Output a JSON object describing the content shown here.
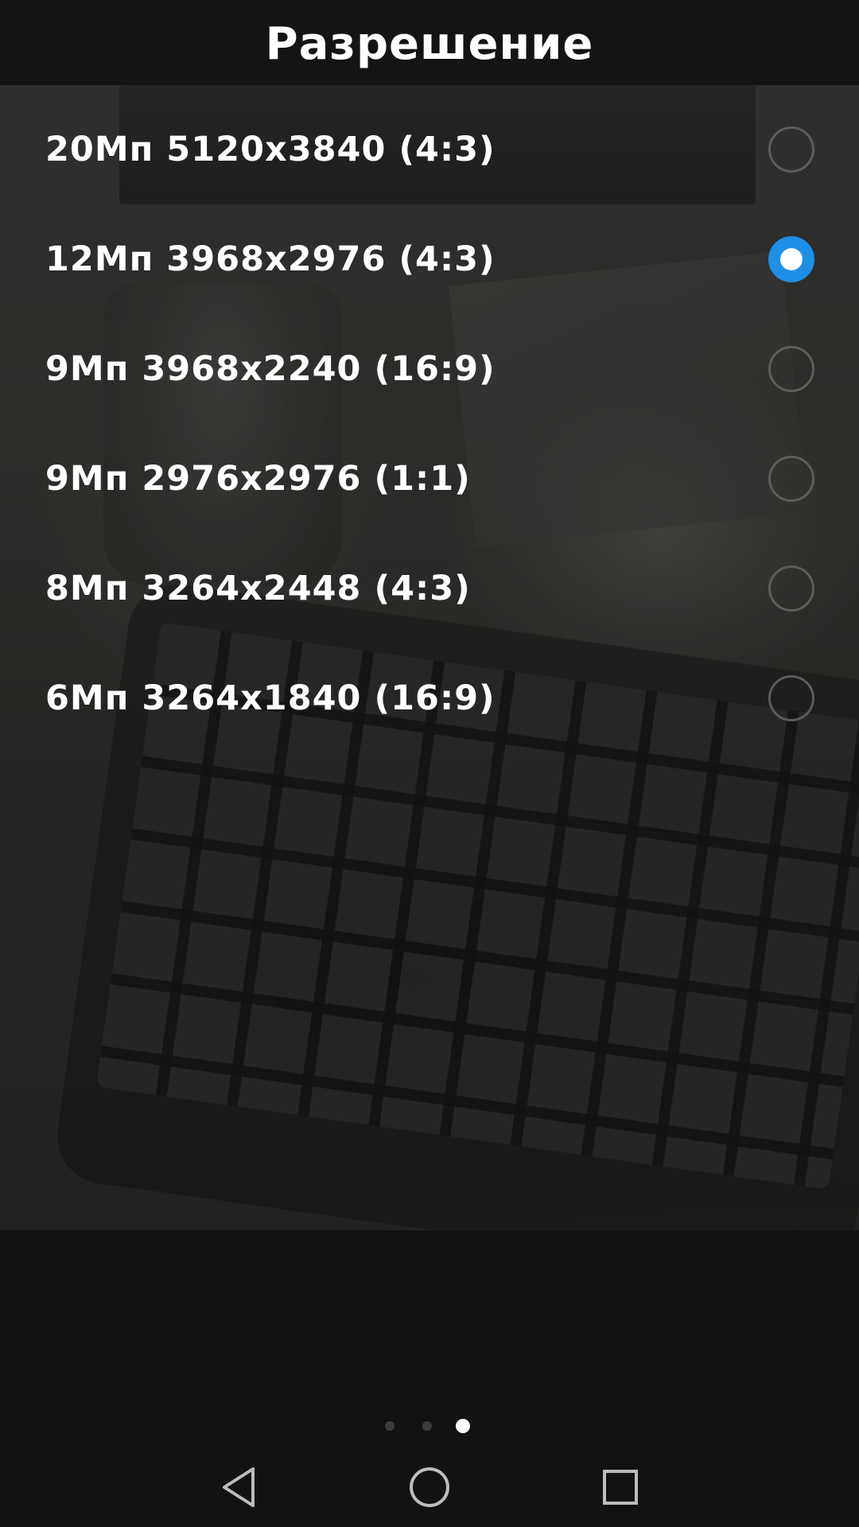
{
  "header": {
    "title": "Разрешение"
  },
  "resolutions": [
    {
      "label": "20Мп 5120x3840 (4:3)",
      "selected": false
    },
    {
      "label": "12Мп 3968x2976 (4:3)",
      "selected": true
    },
    {
      "label": "9Мп 3968x2240 (16:9)",
      "selected": false
    },
    {
      "label": "9Мп 2976x2976 (1:1)",
      "selected": false
    },
    {
      "label": "8Мп 3264x2448 (4:3)",
      "selected": false
    },
    {
      "label": "6Мп 3264x1840 (16:9)",
      "selected": false
    }
  ],
  "pager": {
    "count": 3,
    "active_index": 2
  },
  "navbar": {
    "buttons": [
      "back-icon",
      "home-icon",
      "recents-icon"
    ]
  },
  "colors": {
    "accent": "#1e8fe6",
    "background": "#121212",
    "header_bg": "#141414",
    "text": "#ffffff"
  }
}
